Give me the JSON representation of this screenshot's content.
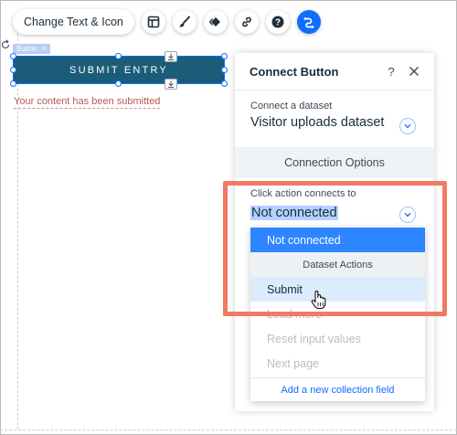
{
  "toolbar": {
    "change_text_label": "Change Text & Icon",
    "icons": [
      "layout-icon",
      "paint-brush-icon",
      "animation-icon",
      "link-icon",
      "help-icon",
      "connect-data-icon"
    ],
    "active_color": "#116dff"
  },
  "element": {
    "tag_label": "Button",
    "button_text": "SUBMIT ENTRY",
    "button_color": "#1b5d78",
    "success_message": "Your content has been submitted"
  },
  "panel": {
    "title": "Connect Button",
    "help": "?",
    "dataset_label": "Connect a dataset",
    "dataset_value": "Visitor uploads dataset",
    "connection_options": "Connection Options",
    "click_action_label": "Click action connects to",
    "click_action_value": "Not connected"
  },
  "dropdown": {
    "items": [
      {
        "label": "Not connected",
        "state": "selected"
      },
      {
        "label": "Dataset Actions",
        "state": "group"
      },
      {
        "label": "Submit",
        "state": "hover"
      },
      {
        "label": "Load more",
        "state": "disabled"
      },
      {
        "label": "Reset input values",
        "state": "disabled"
      },
      {
        "label": "Next page",
        "state": "disabled"
      }
    ],
    "footer": "Add a new collection field"
  },
  "highlight_color": "#f07a63"
}
